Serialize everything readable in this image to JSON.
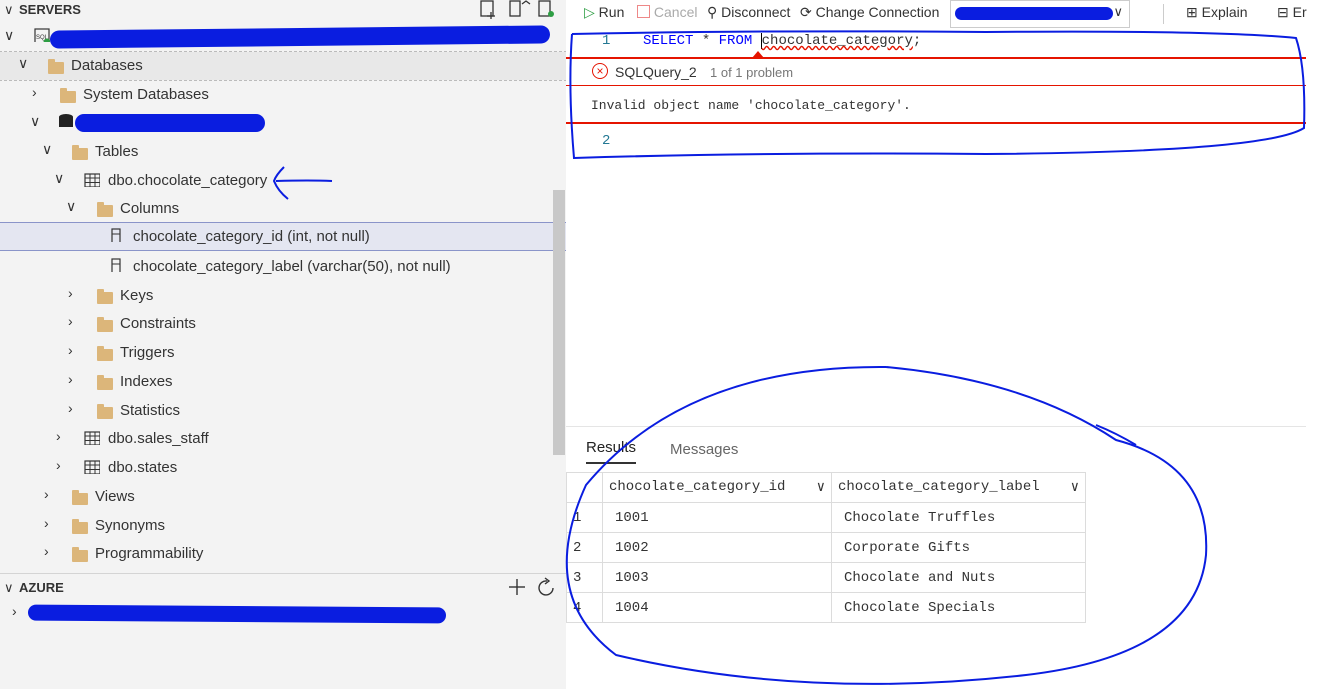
{
  "servers_section": {
    "title": "SERVERS"
  },
  "tree": {
    "databases": "Databases",
    "system_databases": "System Databases",
    "tables": "Tables",
    "table_selected": "dbo.chocolate_category",
    "columns": "Columns",
    "column_1": "chocolate_category_id (int, not null)",
    "column_2": "chocolate_category_label (varchar(50), not null)",
    "keys": "Keys",
    "constraints": "Constraints",
    "triggers": "Triggers",
    "indexes": "Indexes",
    "statistics": "Statistics",
    "table_2": "dbo.sales_staff",
    "table_3": "dbo.states",
    "views": "Views",
    "synonyms": "Synonyms",
    "programmability": "Programmability"
  },
  "azure_section": {
    "title": "AZURE"
  },
  "toolbar": {
    "run": "Run",
    "cancel": "Cancel",
    "disconnect": "Disconnect",
    "change_connection": "Change Connection",
    "explain": "Explain",
    "extra": "Er"
  },
  "editor": {
    "line1_num": "1",
    "line1_kw1": "SELECT",
    "line1_mid": " * ",
    "line1_kw2": "FROM",
    "line1_obj": "chocolate_category",
    "line1_end": ";",
    "problem_source": "SQLQuery_2",
    "problem_count": "1 of 1 problem",
    "problem_message": "Invalid object name 'chocolate_category'.",
    "line2_num": "2"
  },
  "results": {
    "tab_results": "Results",
    "tab_messages": "Messages",
    "columns": [
      "chocolate_category_id",
      "chocolate_category_label"
    ],
    "rows": [
      {
        "n": "1",
        "id": "1001",
        "label": "Chocolate Truffles"
      },
      {
        "n": "2",
        "id": "1002",
        "label": "Corporate Gifts"
      },
      {
        "n": "3",
        "id": "1003",
        "label": "Chocolate and Nuts"
      },
      {
        "n": "4",
        "id": "1004",
        "label": "Chocolate Specials"
      }
    ]
  },
  "colors": {
    "annotation": "#0a1de0",
    "error": "#e51400",
    "keyword": "#0000ff"
  }
}
